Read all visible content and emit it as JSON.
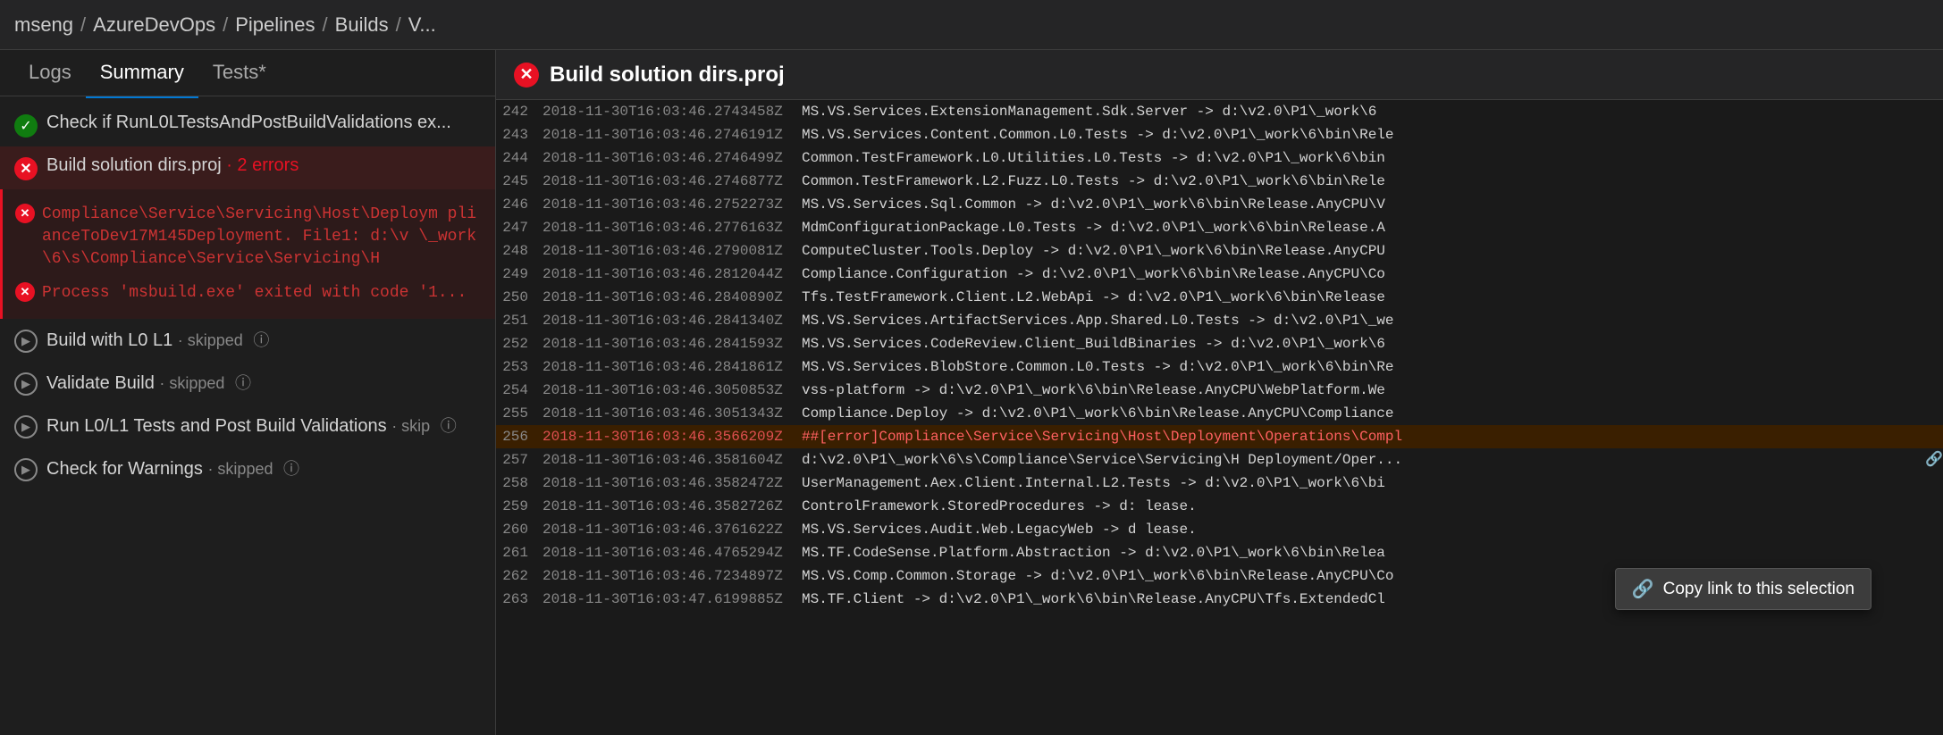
{
  "breadcrumb": {
    "items": [
      "mseng",
      "AzureDevOps",
      "Pipelines",
      "Builds",
      "V..."
    ]
  },
  "left_panel": {
    "tabs": [
      {
        "label": "Logs",
        "active": false
      },
      {
        "label": "Summary",
        "active": true
      },
      {
        "label": "Tests*",
        "active": false
      }
    ],
    "steps": [
      {
        "id": "check-run",
        "icon": "check",
        "title": "Check if RunL0LTestsAndPostBuildValidations ex...",
        "meta": ""
      },
      {
        "id": "build-solution",
        "icon": "error",
        "title": "Build solution dirs.proj",
        "meta": "· 2 errors",
        "meta_class": "error"
      },
      {
        "id": "build-l0-l1",
        "icon": "play",
        "title": "Build with L0 L1",
        "meta": "· skipped",
        "info": true
      },
      {
        "id": "validate-build",
        "icon": "play",
        "title": "Validate Build",
        "meta": "· skipped",
        "info": true
      },
      {
        "id": "run-tests",
        "icon": "play",
        "title": "Run L0/L1 Tests and Post Build Validations",
        "meta": "· skip",
        "info": true
      },
      {
        "id": "check-warnings",
        "icon": "play",
        "title": "Check for Warnings",
        "meta": "· skipped",
        "info": true
      }
    ],
    "errors": [
      {
        "text": "Compliance\\Service\\Servicing\\Host\\Deploym plianceToDev17M145Deployment. File1: d:\\v \\_work\\6\\s\\Compliance\\Service\\Servicing\\H"
      },
      {
        "text": "Process 'msbuild.exe' exited with code '1..."
      }
    ]
  },
  "log_panel": {
    "title": "Build solution dirs.proj",
    "lines": [
      {
        "num": "242",
        "timestamp": "2018-11-30T16:03:46.2743458Z",
        "content": "MS.VS.Services.ExtensionManagement.Sdk.Server -> d:\\v2.0\\P1\\_work\\6"
      },
      {
        "num": "243",
        "timestamp": "2018-11-30T16:03:46.2746191Z",
        "content": "MS.VS.Services.Content.Common.L0.Tests -> d:\\v2.0\\P1\\_work\\6\\bin\\Rele"
      },
      {
        "num": "244",
        "timestamp": "2018-11-30T16:03:46.2746499Z",
        "content": "Common.TestFramework.L0.Utilities.L0.Tests -> d:\\v2.0\\P1\\_work\\6\\bin"
      },
      {
        "num": "245",
        "timestamp": "2018-11-30T16:03:46.2746877Z",
        "content": "Common.TestFramework.L2.Fuzz.L0.Tests -> d:\\v2.0\\P1\\_work\\6\\bin\\Rele"
      },
      {
        "num": "246",
        "timestamp": "2018-11-30T16:03:46.2752273Z",
        "content": "MS.VS.Services.Sql.Common -> d:\\v2.0\\P1\\_work\\6\\bin\\Release.AnyCPU\\V"
      },
      {
        "num": "247",
        "timestamp": "2018-11-30T16:03:46.2776163Z",
        "content": "MdmConfigurationPackage.L0.Tests -> d:\\v2.0\\P1\\_work\\6\\bin\\Release.A"
      },
      {
        "num": "248",
        "timestamp": "2018-11-30T16:03:46.2790081Z",
        "content": "ComputeCluster.Tools.Deploy -> d:\\v2.0\\P1\\_work\\6\\bin\\Release.AnyCPU"
      },
      {
        "num": "249",
        "timestamp": "2018-11-30T16:03:46.2812044Z",
        "content": "Compliance.Configuration -> d:\\v2.0\\P1\\_work\\6\\bin\\Release.AnyCPU\\Co"
      },
      {
        "num": "250",
        "timestamp": "2018-11-30T16:03:46.2840890Z",
        "content": "Tfs.TestFramework.Client.L2.WebApi -> d:\\v2.0\\P1\\_work\\6\\bin\\Release"
      },
      {
        "num": "251",
        "timestamp": "2018-11-30T16:03:46.2841340Z",
        "content": "MS.VS.Services.ArtifactServices.App.Shared.L0.Tests -> d:\\v2.0\\P1\\_we"
      },
      {
        "num": "252",
        "timestamp": "2018-11-30T16:03:46.2841593Z",
        "content": "MS.VS.Services.CodeReview.Client_BuildBinaries -> d:\\v2.0\\P1\\_work\\6"
      },
      {
        "num": "253",
        "timestamp": "2018-11-30T16:03:46.2841861Z",
        "content": "MS.VS.Services.BlobStore.Common.L0.Tests -> d:\\v2.0\\P1\\_work\\6\\bin\\Re"
      },
      {
        "num": "254",
        "timestamp": "2018-11-30T16:03:46.3050853Z",
        "content": "vss-platform -> d:\\v2.0\\P1\\_work\\6\\bin\\Release.AnyCPU\\WebPlatform.We"
      },
      {
        "num": "255",
        "timestamp": "2018-11-30T16:03:46.3051343Z",
        "content": "Compliance.Deploy -> d:\\v2.0\\P1\\_work\\6\\bin\\Release.AnyCPU\\Compliance"
      },
      {
        "num": "256",
        "timestamp": "2018-11-30T16:03:46.3566209Z",
        "content": "##[error]Compliance\\Service\\Servicing\\Host\\Deployment\\Operations\\Compl",
        "type": "error-highlight"
      },
      {
        "num": "257",
        "timestamp": "2018-11-30T16:03:46.3581604Z",
        "content": "d:\\v2.0\\P1\\_work\\6\\s\\Compliance\\Service\\Servicing\\H Deployment/Oper...",
        "type": "normal",
        "has_link": true
      },
      {
        "num": "258",
        "timestamp": "2018-11-30T16:03:46.3582472Z",
        "content": "UserManagement.Aex.Client.Internal.L2.Tests -> d:\\v2.0\\P1\\_work\\6\\bi"
      },
      {
        "num": "259",
        "timestamp": "2018-11-30T16:03:46.3582726Z",
        "content": "ControlFramework.StoredProcedures -> d:  lease."
      },
      {
        "num": "260",
        "timestamp": "2018-11-30T16:03:46.3761622Z",
        "content": "MS.VS.Services.Audit.Web.LegacyWeb -> d  lease."
      },
      {
        "num": "261",
        "timestamp": "2018-11-30T16:03:46.4765294Z",
        "content": "MS.TF.CodeSense.Platform.Abstraction -> d:\\v2.0\\P1\\_work\\6\\bin\\Relea"
      },
      {
        "num": "262",
        "timestamp": "2018-11-30T16:03:46.7234897Z",
        "content": "MS.VS.Comp.Common.Storage -> d:\\v2.0\\P1\\_work\\6\\bin\\Release.AnyCPU\\Co"
      },
      {
        "num": "263",
        "timestamp": "2018-11-30T16:03:47.6199885Z",
        "content": "MS.TF.Client -> d:\\v2.0\\P1\\_work\\6\\bin\\Release.AnyCPU\\Tfs.ExtendedCl"
      }
    ]
  },
  "copy_link_popup": {
    "label": "Copy link to this selection",
    "icon": "link-icon"
  },
  "colors": {
    "error_red": "#e81123",
    "accent_blue": "#0078d4",
    "bg_dark": "#1a1a1a",
    "bg_medium": "#252526"
  }
}
